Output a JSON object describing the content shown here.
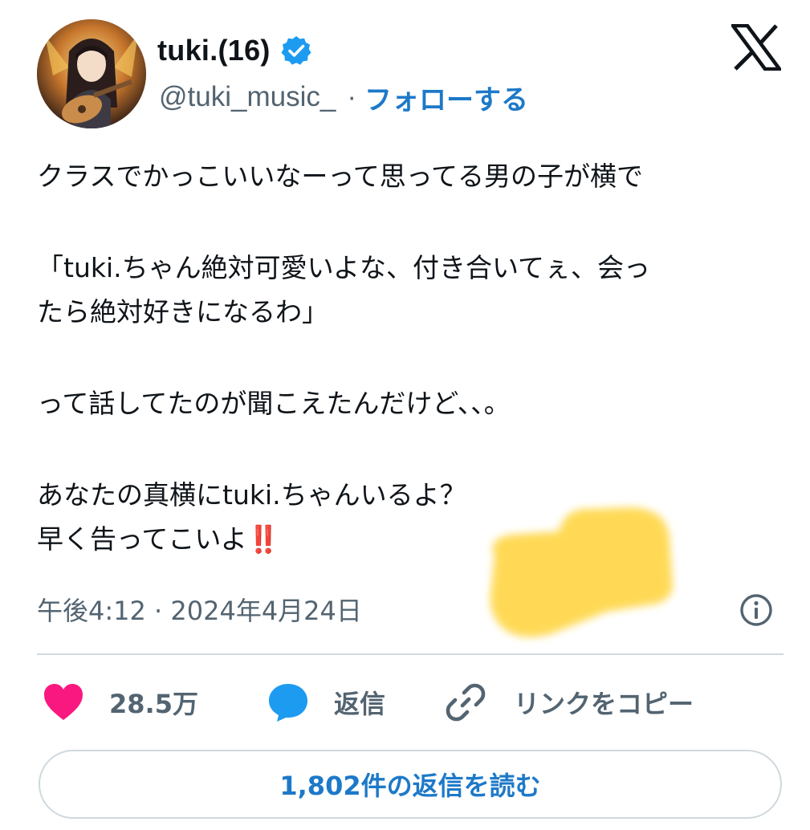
{
  "author": {
    "display_name": "tuki.(16)",
    "handle": "@tuki_music_",
    "separator": "·",
    "follow_label": "フォローする",
    "verified": true,
    "verified_color": "#1d9bf0"
  },
  "tweet": {
    "lines": [
      "クラスでかっこいいなーって思ってる男の子が横で",
      "",
      "「tuki.ちゃん絶対可愛いよな、付き合いてぇ、会っ",
      "たら絶対好きになるわ」",
      "",
      "って話してたのが聞こえたんだけど、、。",
      "",
      "あなたの真横にtuki.ちゃんいるよ？",
      "早く告ってこいよ"
    ],
    "last_line_emoji": "‼️",
    "timestamp": "午後4:12 · 2024年4月24日"
  },
  "actions": {
    "like_count": "28.5万",
    "reply_label": "返信",
    "copy_link_label": "リンクをコピー"
  },
  "read_replies_label": "1,802件の返信を読む",
  "icons": {
    "logo": "x-logo-icon",
    "verified": "verified-badge-icon",
    "info": "info-icon",
    "like": "heart-icon",
    "reply": "speech-bubble-icon",
    "copy": "link-icon"
  },
  "colors": {
    "text": "#0f1419",
    "secondary": "#536471",
    "link": "#1d79c8",
    "heart": "#f91880",
    "reply_icon": "#1d9bf0",
    "divider": "#cfd9de",
    "sticker": "#ffd84d"
  }
}
